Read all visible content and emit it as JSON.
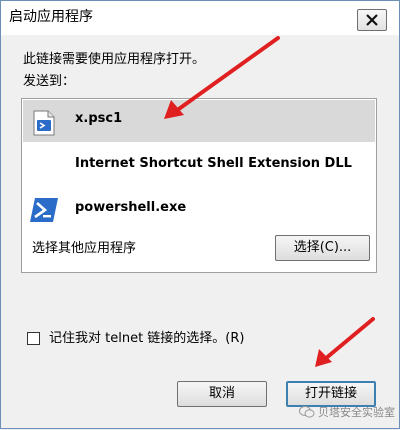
{
  "window": {
    "title": "启动应用程序",
    "close_symbol": "✕"
  },
  "dialog": {
    "description": "此链接需要使用应用程序打开。",
    "send_to_label": "发送到："
  },
  "list": {
    "items": [
      {
        "label": "x.psc1",
        "icon": "psc1-file-icon",
        "selected": true
      },
      {
        "label": "Internet Shortcut Shell Extension DLL",
        "icon": null
      },
      {
        "label": "powershell.exe",
        "icon": "powershell-icon"
      }
    ],
    "other_apps_label": "选择其他应用程序",
    "choose_button": "选择(C)..."
  },
  "remember": {
    "label": "记住我对 telnet 链接的选择。(R)",
    "checked": false
  },
  "buttons": {
    "cancel": "取消",
    "open_link": "打开链接"
  },
  "watermark": {
    "text": "贝塔安全实验室"
  },
  "colors": {
    "annotation_arrow": "#e02020",
    "selection_bg": "#d9d9d9",
    "powershell_blue": "#2a6cc7"
  }
}
